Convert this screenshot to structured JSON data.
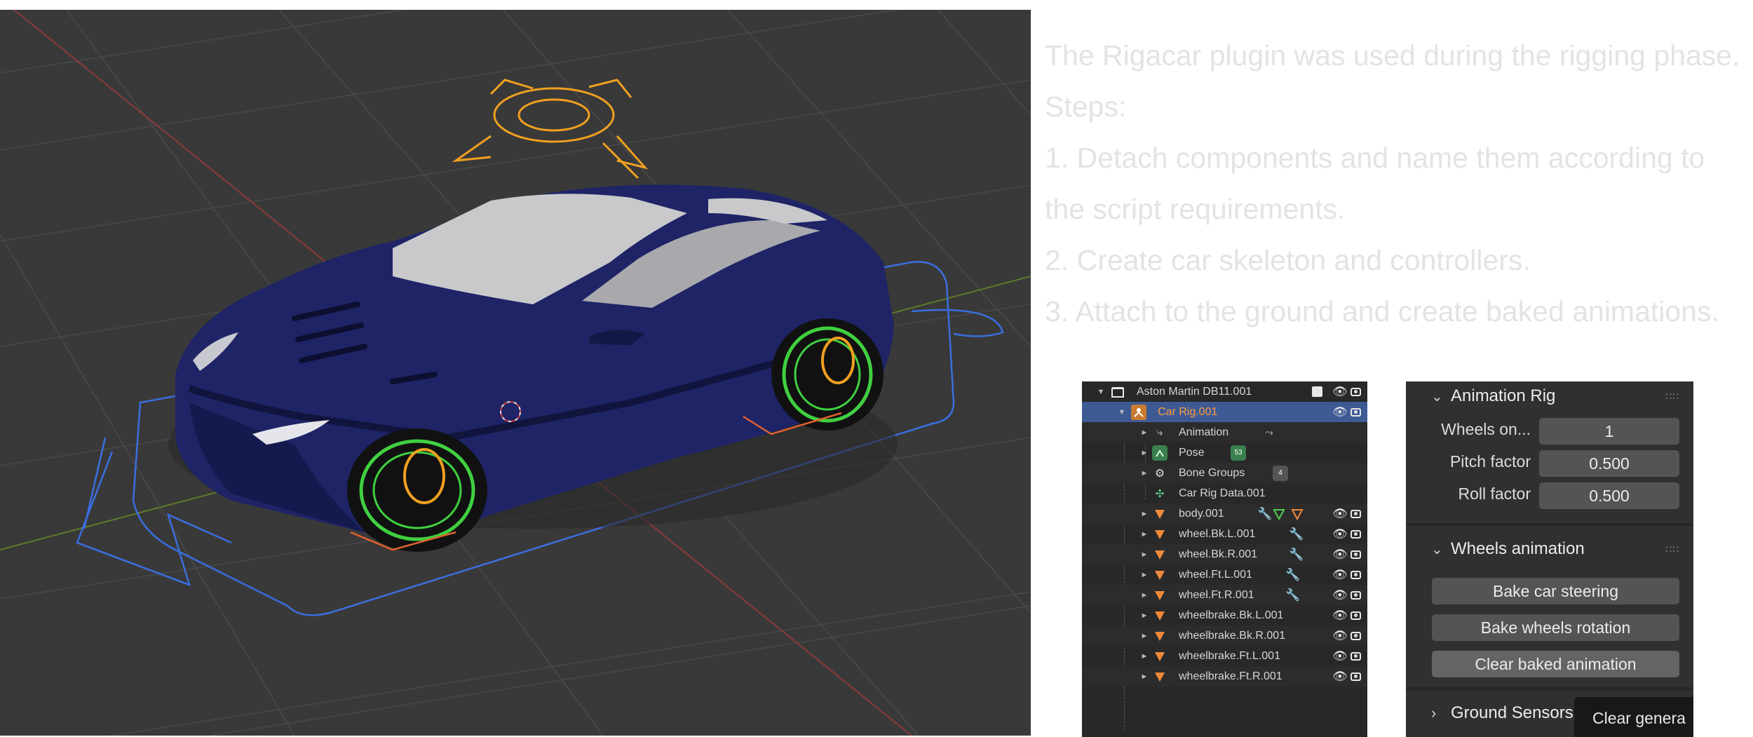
{
  "notes": [
    "The Rigacar plugin was used during the rigging phase.",
    "Steps:",
    "1. Detach components and name them according to",
    "the script requirements.",
    "2. Create car skeleton and controllers.",
    "3. Attach to the ground and create baked animations."
  ],
  "outliner": {
    "collection": "Aston Martin DB11.001",
    "rig": "Car Rig.001",
    "children": [
      {
        "label": "Animation",
        "icon": "action-icon"
      },
      {
        "label": "Pose",
        "icon": "pose-icon",
        "badge": "53"
      },
      {
        "label": "Bone Groups",
        "icon": "bone-groups-icon",
        "badge": "4"
      },
      {
        "label": "Car Rig Data.001",
        "icon": "armature-data-icon"
      }
    ],
    "meshes": [
      "body.001",
      "wheel.Bk.L.001",
      "wheel.Bk.R.001",
      "wheel.Ft.L.001",
      "wheel.Ft.R.001",
      "wheelbrake.Bk.L.001",
      "wheelbrake.Bk.R.001",
      "wheelbrake.Ft.L.001",
      "wheelbrake.Ft.R.001"
    ]
  },
  "properties": {
    "animation_rig_title": "Animation Rig",
    "fields": [
      {
        "label": "Wheels on...",
        "value": "1"
      },
      {
        "label": "Pitch factor",
        "value": "0.500"
      },
      {
        "label": "Roll factor",
        "value": "0.500"
      }
    ],
    "wheels_animation_title": "Wheels animation",
    "buttons": [
      "Bake car steering",
      "Bake wheels rotation",
      "Clear baked animation"
    ],
    "ground_sensors_title": "Ground Sensors",
    "tooltip": "Clear genera"
  },
  "colors": {
    "viewport_bg": "#393939",
    "car_body": "#1e2466",
    "rig_orange": "#f0a020",
    "rig_blue": "#3a6fe0",
    "wheel_green": "#40d040",
    "selection_blue": "#3d5a95"
  }
}
